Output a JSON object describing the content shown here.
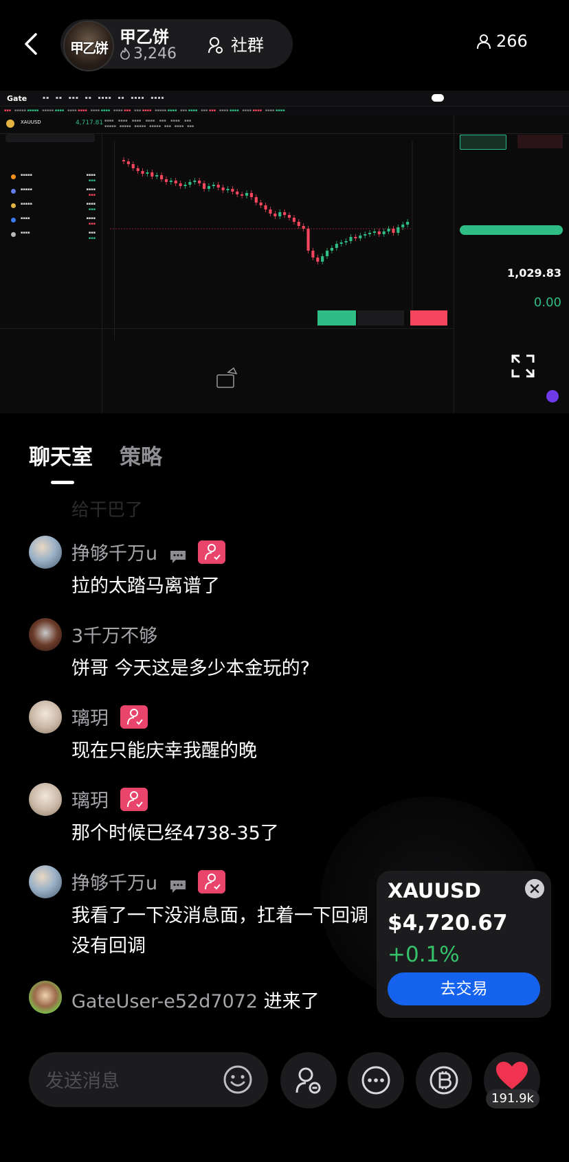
{
  "header": {
    "host_name": "甲乙饼",
    "host_likes": "3,246",
    "host_logo_text": "甲乙饼",
    "community_label": "社群",
    "viewer_count": "266"
  },
  "screen": {
    "brand": "Gate",
    "symbol": "XAUUSD",
    "price": "4,717.81",
    "balance": "1,029.83",
    "pnl": "0.00"
  },
  "tabs": [
    {
      "label": "聊天室",
      "active": true
    },
    {
      "label": "策略",
      "active": false
    }
  ],
  "faded_text": "给干巴了",
  "messages": [
    {
      "user": "挣够千万u",
      "text": "拉的太踏马离谱了",
      "badges": [
        "chat-icon",
        "heart-badge"
      ]
    },
    {
      "user": "3千万不够",
      "text": "饼哥  今天这是多少本金玩的?",
      "badges": []
    },
    {
      "user": "璃玥",
      "text": "现在只能庆幸我醒的晚",
      "badges": [
        "heart-badge"
      ]
    },
    {
      "user": "璃玥",
      "text": "那个时候已经4738-35了",
      "badges": [
        "heart-badge"
      ]
    },
    {
      "user": "挣够千万u",
      "text": "我看了一下没消息面，扛着一下回调 没有回调",
      "text_line1": "我看了一下没消息面，扛着一下回调",
      "text_line2": "没有回调",
      "badges": [
        "chat-icon",
        "heart-badge"
      ]
    }
  ],
  "join_event": {
    "user": "GateUser-e52d7072",
    "action": "进来了"
  },
  "price_card": {
    "symbol": "XAUUSD",
    "price": "$4,720.67",
    "change": "+0.1%",
    "trade_button": "去交易",
    "up_color": "#35c26b",
    "button_color": "#1462ee"
  },
  "bottom_bar": {
    "input_placeholder": "发送消息",
    "like_count": "191.9k",
    "heart_color": "#f0334f"
  }
}
